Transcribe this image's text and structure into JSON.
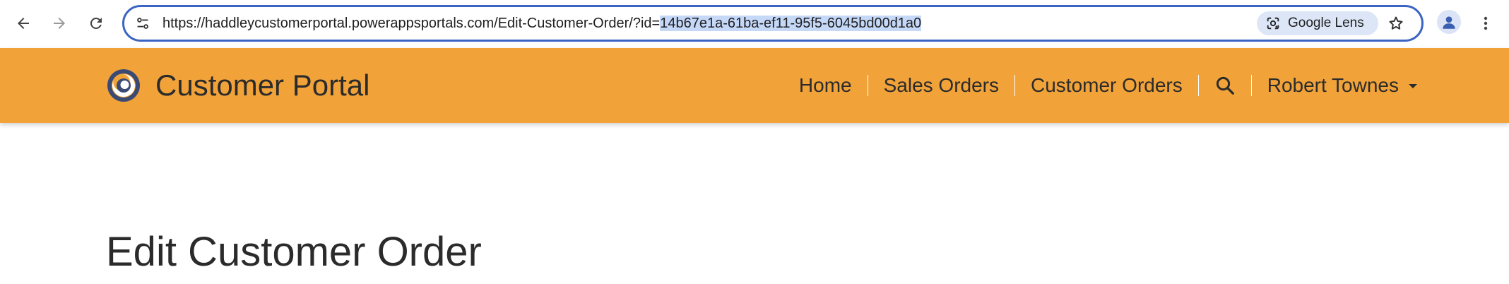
{
  "browser": {
    "url_prefix": "https://haddleycustomerportal.powerappsportals.com/Edit-Customer-Order/?id=",
    "url_selected": "14b67e1a-61ba-ef11-95f5-6045bd00d1a0",
    "lens_label": "Google Lens",
    "icons": {
      "back": "arrow-left-icon",
      "forward": "arrow-right-icon",
      "reload": "reload-icon",
      "site_info": "tune-icon",
      "lens": "google-lens-icon",
      "bookmark": "star-icon",
      "profile": "person-icon",
      "menu": "more-vert-icon"
    },
    "colors": {
      "omnibox_border": "#3b64c3",
      "selection": "#c5d8f8",
      "lens_chip": "#dde6f7"
    }
  },
  "header": {
    "brand_title": "Customer Portal",
    "background": "#f1a33a",
    "nav": [
      {
        "label": "Home"
      },
      {
        "label": "Sales Orders"
      },
      {
        "label": "Customer Orders"
      }
    ],
    "search_icon": "search-icon",
    "user_name": "Robert Townes"
  },
  "main": {
    "page_title": "Edit Customer Order"
  }
}
